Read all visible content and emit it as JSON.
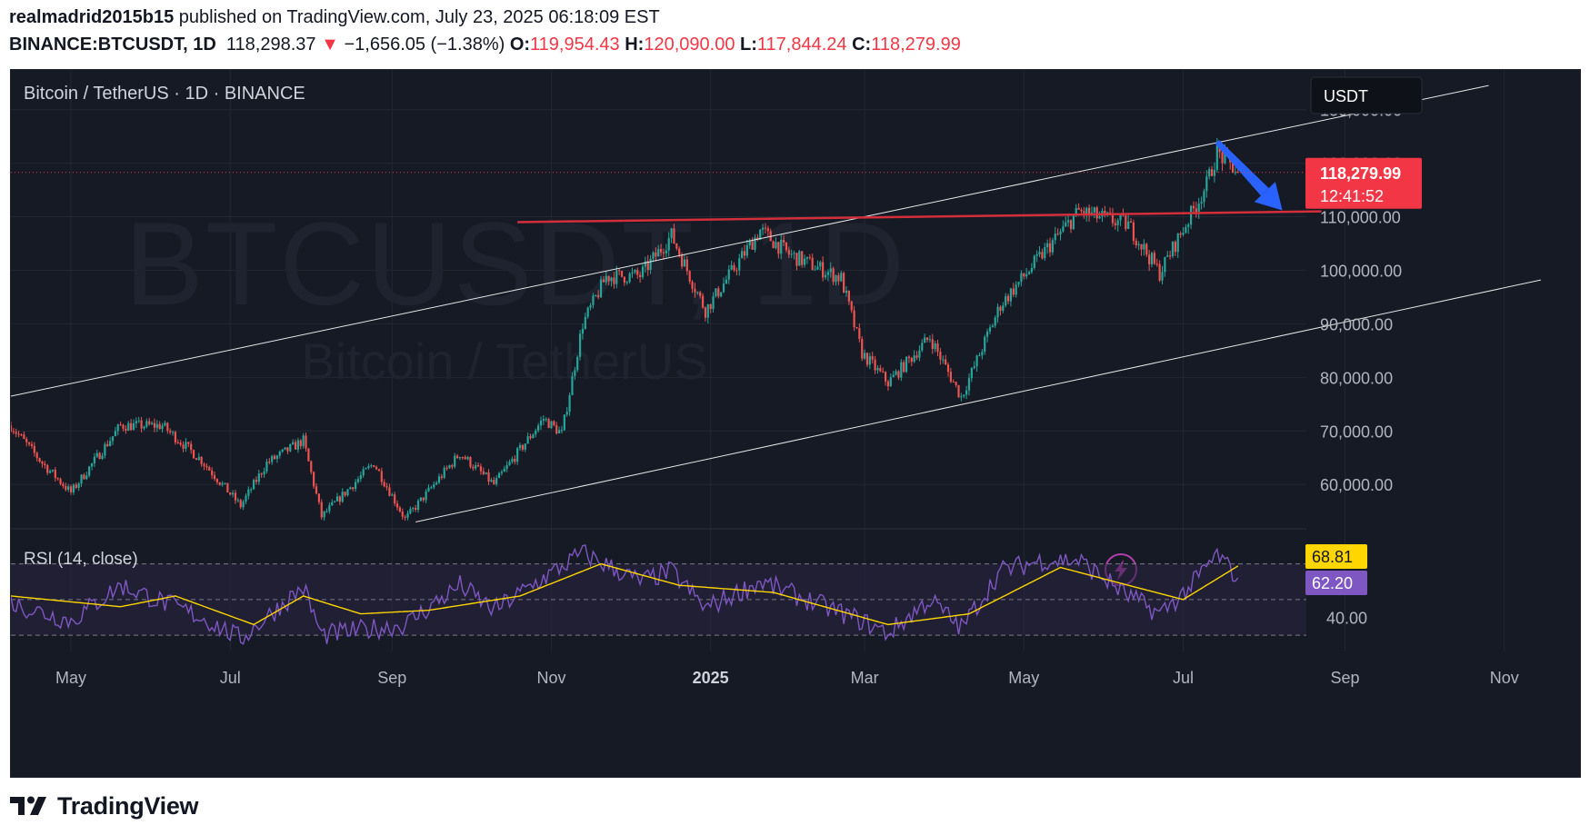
{
  "header": {
    "author": "realmadrid2015b15",
    "published_text": "published on TradingView.com, July 23, 2025 06:18:09 EST",
    "symbol": "BINANCE:BTCUSDT, 1D",
    "last": "118,298.37",
    "change_arrow": "▼",
    "change": "−1,656.05 (−1.38%)",
    "o_label": "O:",
    "o_value": "119,954.43",
    "h_label": "H:",
    "h_value": "120,090.00",
    "l_label": "L:",
    "l_value": "117,844.24",
    "c_label": "C:",
    "c_value": "118,279.99"
  },
  "footer": {
    "brand": "TradingView",
    "logo_icon": "tradingview-logo-icon"
  },
  "colors": {
    "background": "#161a25",
    "grid": "#232733",
    "text": "#b2b5be",
    "up": "#26a69a",
    "down": "#ef5350",
    "resistance": "#d32f3b",
    "channel": "#e6e6e6",
    "arrow": "#2962ff",
    "rsi": "#7e57c2",
    "rsi_ma": "#ffd600",
    "rsi_band": "#2a2542",
    "price_badge": "#f23645"
  },
  "chart_data": [
    {
      "type": "candlestick",
      "title": "Bitcoin / TetherUS · 1D · BINANCE",
      "watermark": "BTCUSDT, 1D",
      "watermark_sub": "Bitcoin / TetherUS",
      "currency": "USDT",
      "ylim": [
        52000,
        136000
      ],
      "y_ticks": [
        "130,000.00",
        "110,000.00",
        "100,000.00",
        "90,000.00",
        "80,000.00",
        "70,000.00",
        "60,000.00"
      ],
      "y_tick_values": [
        130000,
        110000,
        100000,
        90000,
        80000,
        70000,
        60000
      ],
      "x_range": [
        "2024-04-08",
        "2025-11-30"
      ],
      "x_ticks": [
        "May",
        "Jul",
        "Sep",
        "Nov",
        "2025",
        "Mar",
        "May",
        "Jul",
        "Sep",
        "Nov"
      ],
      "x_tick_dates": [
        "2024-05-01",
        "2024-07-01",
        "2024-09-01",
        "2024-11-01",
        "2025-01-01",
        "2025-03-01",
        "2025-05-01",
        "2025-07-01",
        "2025-09-01",
        "2025-11-01"
      ],
      "last_price": {
        "value": 118279.99,
        "label": "118,279.99",
        "countdown": "12:41:52"
      },
      "close_path": [
        [
          "2024-04-08",
          71000
        ],
        [
          "2024-04-20",
          64000
        ],
        [
          "2024-05-01",
          58500
        ],
        [
          "2024-05-20",
          71000
        ],
        [
          "2024-06-05",
          71000
        ],
        [
          "2024-06-20",
          64500
        ],
        [
          "2024-07-05",
          56000
        ],
        [
          "2024-07-15",
          64000
        ],
        [
          "2024-07-29",
          68200
        ],
        [
          "2024-08-05",
          54000
        ],
        [
          "2024-08-25",
          64000
        ],
        [
          "2024-09-06",
          53500
        ],
        [
          "2024-09-27",
          65800
        ],
        [
          "2024-10-10",
          60000
        ],
        [
          "2024-10-29",
          72300
        ],
        [
          "2024-11-05",
          69500
        ],
        [
          "2024-11-13",
          90000
        ],
        [
          "2024-11-22",
          98800
        ],
        [
          "2024-12-05",
          99000
        ],
        [
          "2024-12-17",
          106500
        ],
        [
          "2024-12-30",
          92500
        ],
        [
          "2025-01-20",
          107500
        ],
        [
          "2025-01-31",
          103000
        ],
        [
          "2025-02-20",
          98500
        ],
        [
          "2025-02-28",
          84500
        ],
        [
          "2025-03-10",
          79000
        ],
        [
          "2025-03-26",
          87500
        ],
        [
          "2025-04-07",
          76300
        ],
        [
          "2025-04-22",
          93500
        ],
        [
          "2025-05-08",
          103000
        ],
        [
          "2025-05-22",
          111000
        ],
        [
          "2025-06-10",
          108500
        ],
        [
          "2025-06-22",
          99500
        ],
        [
          "2025-07-03",
          109500
        ],
        [
          "2025-07-10",
          116000
        ],
        [
          "2025-07-14",
          122000
        ],
        [
          "2025-07-22",
          118280
        ]
      ],
      "annotations": {
        "resistance_line": {
          "from": [
            "2024-10-19",
            109000
          ],
          "to": [
            "2025-08-23",
            111000
          ]
        },
        "channel_upper": {
          "from": [
            "2024-04-08",
            76500
          ],
          "to": [
            "2025-10-26",
            134500
          ]
        },
        "channel_lower": {
          "from": [
            "2024-09-10",
            53000
          ],
          "to": [
            "2025-11-15",
            98200
          ]
        },
        "arrow": {
          "from": [
            "2025-07-14",
            124000
          ],
          "to": [
            "2025-08-08",
            111200
          ],
          "direction": "down"
        }
      },
      "icons": [
        "lightning-icon"
      ]
    },
    {
      "type": "line",
      "title": "RSI (14, close)",
      "ylim": [
        25,
        82
      ],
      "bands": [
        70,
        50,
        30
      ],
      "y_ticks": [
        "40.00"
      ],
      "y_tick_values": [
        40
      ],
      "series": [
        {
          "name": "RSI",
          "last": "62.20",
          "values": [
            [
              "2024-04-08",
              48
            ],
            [
              "2024-05-01",
              38
            ],
            [
              "2024-05-20",
              58
            ],
            [
              "2024-06-20",
              40
            ],
            [
              "2024-07-05",
              28
            ],
            [
              "2024-07-29",
              57
            ],
            [
              "2024-08-05",
              30
            ],
            [
              "2024-09-06",
              36
            ],
            [
              "2024-09-27",
              58
            ],
            [
              "2024-10-10",
              44
            ],
            [
              "2024-10-29",
              62
            ],
            [
              "2024-11-13",
              76
            ],
            [
              "2024-12-05",
              60
            ],
            [
              "2024-12-17",
              66
            ],
            [
              "2024-12-30",
              45
            ],
            [
              "2025-01-20",
              60
            ],
            [
              "2025-02-28",
              38
            ],
            [
              "2025-03-10",
              31
            ],
            [
              "2025-03-26",
              50
            ],
            [
              "2025-04-07",
              34
            ],
            [
              "2025-04-22",
              66
            ],
            [
              "2025-05-08",
              72
            ],
            [
              "2025-05-22",
              72
            ],
            [
              "2025-06-10",
              52
            ],
            [
              "2025-06-22",
              42
            ],
            [
              "2025-07-03",
              56
            ],
            [
              "2025-07-14",
              75
            ],
            [
              "2025-07-22",
              62.2
            ]
          ]
        },
        {
          "name": "RSI MA",
          "last": "68.81",
          "values": [
            [
              "2024-04-08",
              52
            ],
            [
              "2024-05-20",
              46
            ],
            [
              "2024-06-10",
              52
            ],
            [
              "2024-07-10",
              36
            ],
            [
              "2024-07-29",
              52
            ],
            [
              "2024-08-20",
              42
            ],
            [
              "2024-09-15",
              44
            ],
            [
              "2024-10-20",
              52
            ],
            [
              "2024-11-20",
              70
            ],
            [
              "2024-12-20",
              58
            ],
            [
              "2025-01-25",
              54
            ],
            [
              "2025-03-10",
              36
            ],
            [
              "2025-04-10",
              42
            ],
            [
              "2025-05-15",
              68
            ],
            [
              "2025-06-10",
              58
            ],
            [
              "2025-07-01",
              50
            ],
            [
              "2025-07-22",
              68.81
            ]
          ]
        }
      ]
    }
  ]
}
